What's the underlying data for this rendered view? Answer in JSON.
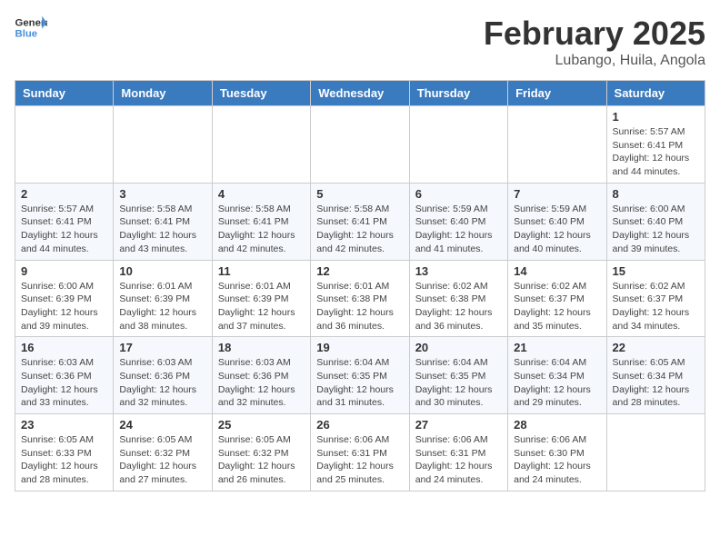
{
  "header": {
    "logo_general": "General",
    "logo_blue": "Blue",
    "title": "February 2025",
    "location": "Lubango, Huila, Angola"
  },
  "days_of_week": [
    "Sunday",
    "Monday",
    "Tuesday",
    "Wednesday",
    "Thursday",
    "Friday",
    "Saturday"
  ],
  "weeks": [
    [
      {
        "day": null
      },
      {
        "day": null
      },
      {
        "day": null
      },
      {
        "day": null
      },
      {
        "day": null
      },
      {
        "day": null
      },
      {
        "day": 1,
        "sunrise": "5:57 AM",
        "sunset": "6:41 PM",
        "daylight": "12 hours and 44 minutes."
      }
    ],
    [
      {
        "day": 2,
        "sunrise": "5:57 AM",
        "sunset": "6:41 PM",
        "daylight": "12 hours and 44 minutes."
      },
      {
        "day": 3,
        "sunrise": "5:58 AM",
        "sunset": "6:41 PM",
        "daylight": "12 hours and 43 minutes."
      },
      {
        "day": 4,
        "sunrise": "5:58 AM",
        "sunset": "6:41 PM",
        "daylight": "12 hours and 42 minutes."
      },
      {
        "day": 5,
        "sunrise": "5:58 AM",
        "sunset": "6:41 PM",
        "daylight": "12 hours and 42 minutes."
      },
      {
        "day": 6,
        "sunrise": "5:59 AM",
        "sunset": "6:40 PM",
        "daylight": "12 hours and 41 minutes."
      },
      {
        "day": 7,
        "sunrise": "5:59 AM",
        "sunset": "6:40 PM",
        "daylight": "12 hours and 40 minutes."
      },
      {
        "day": 8,
        "sunrise": "6:00 AM",
        "sunset": "6:40 PM",
        "daylight": "12 hours and 39 minutes."
      }
    ],
    [
      {
        "day": 9,
        "sunrise": "6:00 AM",
        "sunset": "6:39 PM",
        "daylight": "12 hours and 39 minutes."
      },
      {
        "day": 10,
        "sunrise": "6:01 AM",
        "sunset": "6:39 PM",
        "daylight": "12 hours and 38 minutes."
      },
      {
        "day": 11,
        "sunrise": "6:01 AM",
        "sunset": "6:39 PM",
        "daylight": "12 hours and 37 minutes."
      },
      {
        "day": 12,
        "sunrise": "6:01 AM",
        "sunset": "6:38 PM",
        "daylight": "12 hours and 36 minutes."
      },
      {
        "day": 13,
        "sunrise": "6:02 AM",
        "sunset": "6:38 PM",
        "daylight": "12 hours and 36 minutes."
      },
      {
        "day": 14,
        "sunrise": "6:02 AM",
        "sunset": "6:37 PM",
        "daylight": "12 hours and 35 minutes."
      },
      {
        "day": 15,
        "sunrise": "6:02 AM",
        "sunset": "6:37 PM",
        "daylight": "12 hours and 34 minutes."
      }
    ],
    [
      {
        "day": 16,
        "sunrise": "6:03 AM",
        "sunset": "6:36 PM",
        "daylight": "12 hours and 33 minutes."
      },
      {
        "day": 17,
        "sunrise": "6:03 AM",
        "sunset": "6:36 PM",
        "daylight": "12 hours and 32 minutes."
      },
      {
        "day": 18,
        "sunrise": "6:03 AM",
        "sunset": "6:36 PM",
        "daylight": "12 hours and 32 minutes."
      },
      {
        "day": 19,
        "sunrise": "6:04 AM",
        "sunset": "6:35 PM",
        "daylight": "12 hours and 31 minutes."
      },
      {
        "day": 20,
        "sunrise": "6:04 AM",
        "sunset": "6:35 PM",
        "daylight": "12 hours and 30 minutes."
      },
      {
        "day": 21,
        "sunrise": "6:04 AM",
        "sunset": "6:34 PM",
        "daylight": "12 hours and 29 minutes."
      },
      {
        "day": 22,
        "sunrise": "6:05 AM",
        "sunset": "6:34 PM",
        "daylight": "12 hours and 28 minutes."
      }
    ],
    [
      {
        "day": 23,
        "sunrise": "6:05 AM",
        "sunset": "6:33 PM",
        "daylight": "12 hours and 28 minutes."
      },
      {
        "day": 24,
        "sunrise": "6:05 AM",
        "sunset": "6:32 PM",
        "daylight": "12 hours and 27 minutes."
      },
      {
        "day": 25,
        "sunrise": "6:05 AM",
        "sunset": "6:32 PM",
        "daylight": "12 hours and 26 minutes."
      },
      {
        "day": 26,
        "sunrise": "6:06 AM",
        "sunset": "6:31 PM",
        "daylight": "12 hours and 25 minutes."
      },
      {
        "day": 27,
        "sunrise": "6:06 AM",
        "sunset": "6:31 PM",
        "daylight": "12 hours and 24 minutes."
      },
      {
        "day": 28,
        "sunrise": "6:06 AM",
        "sunset": "6:30 PM",
        "daylight": "12 hours and 24 minutes."
      },
      {
        "day": null
      }
    ]
  ]
}
